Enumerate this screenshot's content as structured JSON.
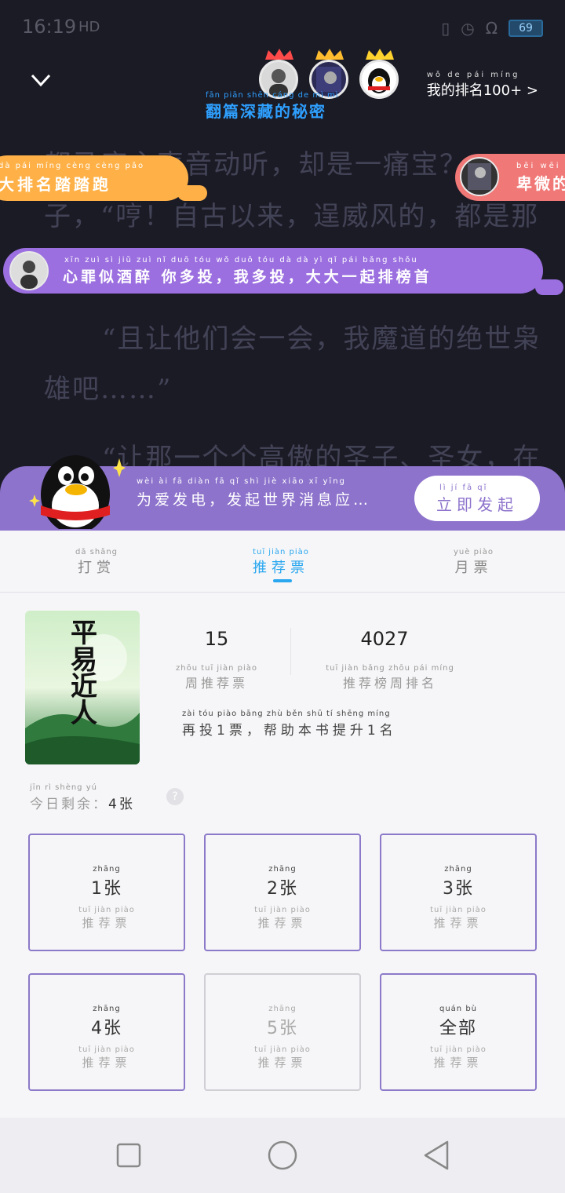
{
  "status_bar": {
    "time": "16:19",
    "signal": "HD",
    "battery": "69"
  },
  "reading_text": {
    "line1": "都马座主声音动听，却是一痛宝？",
    "line2": "子，“哼！自古以来，逞威风的，都是那",
    "line3": "“且让他们会一会，我魔道的绝世枭",
    "line4": "雄吧……”",
    "line5": "“让那一个个高傲的圣子、圣女，在"
  },
  "header": {
    "my_rank_label": "我的排名100+",
    "rank_arrow": ">",
    "subtitle": "翻篇深藏的秘密",
    "subtitle_pinyin": "fān piān shēn cáng de mì mì"
  },
  "danmaku": {
    "orange": "大排名踏踏跑",
    "orange_pinyin": "dà pái míng cèng cèng pǎo",
    "pink": "卑微的",
    "pink_pinyin": "bēi wēi",
    "purple": "心罪似酒醉 你多投，我多投，大大一起排榜首",
    "purple_pinyin": "xīn zuì sì jiǔ zuì  nǐ duō tóu  wǒ duō tóu  dà dà yì qǐ pái bǎng shǒu"
  },
  "banner": {
    "text": "为爱发电，发起世界消息应…",
    "text_pinyin": "wèi ài fā diàn  fā qǐ shì jiè xiāo xī yīng",
    "button": "立即发起",
    "button_pinyin": "lì jí fā qǐ"
  },
  "tabs": [
    {
      "label": "打赏",
      "pinyin": "dǎ shǎng"
    },
    {
      "label": "推荐票",
      "pinyin": "tuī jiàn piào"
    },
    {
      "label": "月票",
      "pinyin": "yuè piào"
    }
  ],
  "book": {
    "cover_title": "平易近人",
    "weekly_votes": "15",
    "weekly_votes_label": "周推荐票",
    "weekly_votes_pinyin": "zhōu tuī jiàn piào",
    "rank": "4027",
    "rank_label": "推荐榜周排名",
    "rank_pinyin": "tuī jiàn bǎng zhōu pái míng",
    "hint": "再投1票，帮助本书提升1名",
    "hint_pinyin": "zài tóu  piào  bāng zhù běn shū tí shēng  míng"
  },
  "remaining": {
    "label": "今日剩余：",
    "label_pinyin": "jīn rì shèng yú",
    "count": "4张",
    "help": "?"
  },
  "vote_options": [
    {
      "amount": "1张",
      "pinyin": "zhāng",
      "label": "推荐票",
      "label_pinyin": "tuī jiàn piào"
    },
    {
      "amount": "2张",
      "pinyin": "zhāng",
      "label": "推荐票",
      "label_pinyin": "tuī jiàn piào"
    },
    {
      "amount": "3张",
      "pinyin": "zhāng",
      "label": "推荐票",
      "label_pinyin": "tuī jiàn piào"
    },
    {
      "amount": "4张",
      "pinyin": "zhāng",
      "label": "推荐票",
      "label_pinyin": "tuī jiàn piào"
    },
    {
      "amount": "5张",
      "pinyin": "zhāng",
      "label": "推荐票",
      "label_pinyin": "tuī jiàn piào"
    },
    {
      "amount": "全部",
      "pinyin": "quán bù",
      "label": "推荐票",
      "label_pinyin": "tuī jiàn piào"
    }
  ],
  "colors": {
    "accent": "#2aa7ef",
    "purple": "#8d73cc",
    "border": "#8c79c9"
  }
}
